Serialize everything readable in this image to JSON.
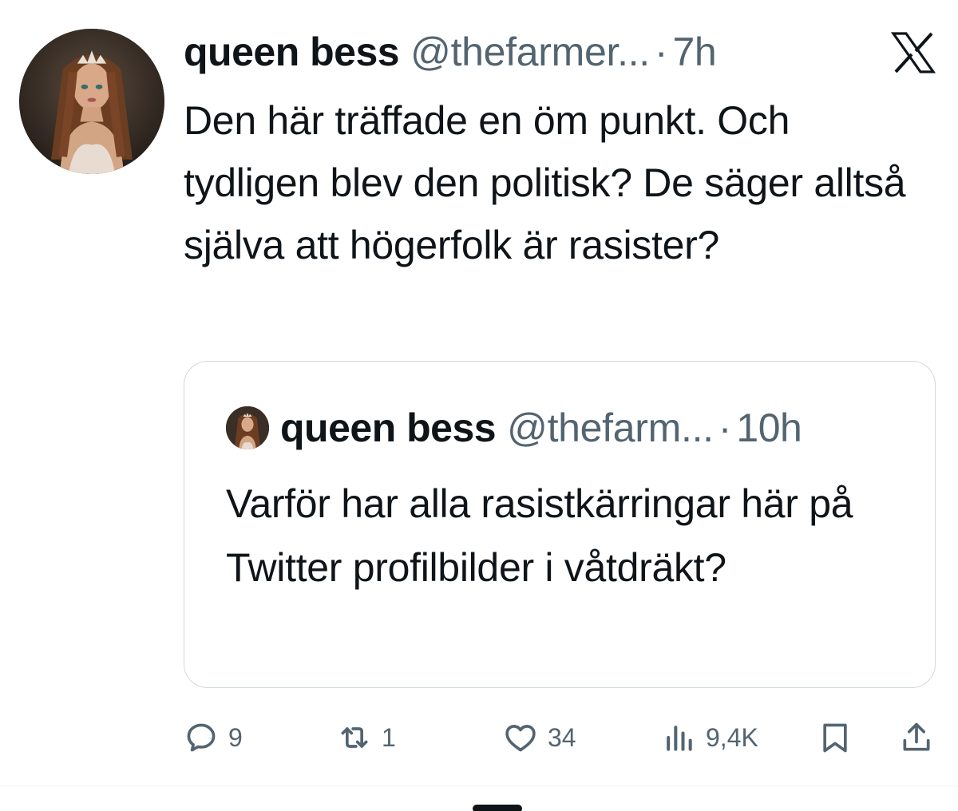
{
  "tweet": {
    "author": {
      "display_name": "queen bess",
      "handle": "@thefarmer...",
      "separator": "·",
      "time": "7h"
    },
    "text": "Den här träffade en öm punkt. Och tydligen blev den politisk? De säger alltså själva att högerfolk är rasister?",
    "quoted": {
      "display_name": "queen bess",
      "handle": "@thefarm...",
      "separator": "·",
      "time": "10h",
      "text": "Varför har alla rasistkärringar här på Twitter profilbilder i våtdräkt?"
    },
    "actions": {
      "replies": "9",
      "reposts": "1",
      "likes": "34",
      "views": "9,4K"
    }
  },
  "icons": {
    "logo": "x-logo-icon",
    "reply": "reply-icon",
    "repost": "repost-icon",
    "like": "heart-icon",
    "views": "views-chart-icon",
    "bookmark": "bookmark-icon",
    "share": "share-icon"
  },
  "colors": {
    "text_primary": "#0f1419",
    "text_secondary": "#536471",
    "border": "#cfd9de"
  }
}
